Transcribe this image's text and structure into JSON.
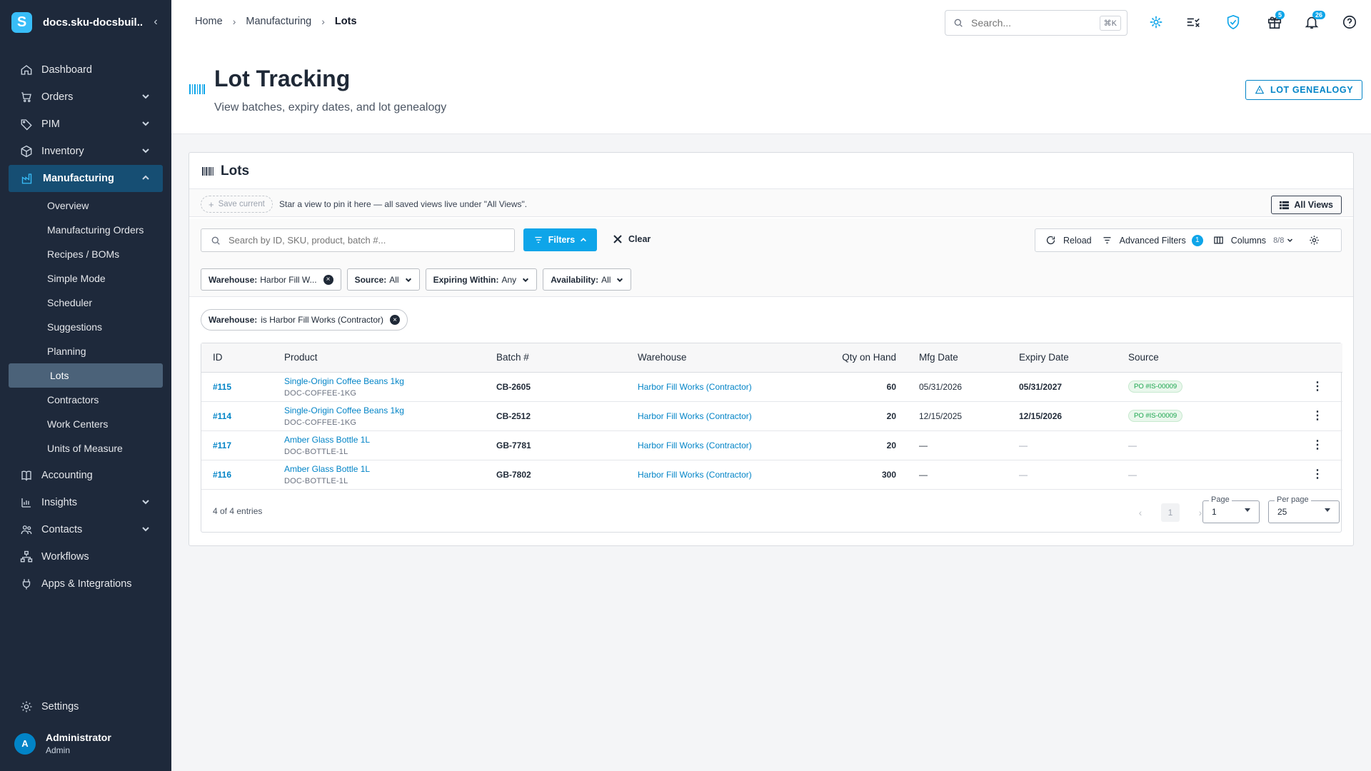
{
  "app": {
    "name": "docs.sku-docsbuil...",
    "logo_letter": "S"
  },
  "sidebar": {
    "items": [
      {
        "label": "Dashboard"
      },
      {
        "label": "Orders"
      },
      {
        "label": "PIM"
      },
      {
        "label": "Inventory"
      },
      {
        "label": "Manufacturing"
      }
    ],
    "manufacturing_sub": [
      {
        "label": "Overview"
      },
      {
        "label": "Manufacturing Orders"
      },
      {
        "label": "Recipes / BOMs"
      },
      {
        "label": "Simple Mode"
      },
      {
        "label": "Scheduler"
      },
      {
        "label": "Suggestions"
      },
      {
        "label": "Planning"
      },
      {
        "label": "Lots"
      },
      {
        "label": "Contractors"
      },
      {
        "label": "Work Centers"
      },
      {
        "label": "Units of Measure"
      }
    ],
    "items_after": [
      {
        "label": "Accounting"
      },
      {
        "label": "Insights"
      },
      {
        "label": "Contacts"
      },
      {
        "label": "Workflows"
      },
      {
        "label": "Apps & Integrations"
      }
    ],
    "settings_label": "Settings",
    "user": {
      "name": "Administrator",
      "role": "Admin",
      "initial": "A"
    }
  },
  "header": {
    "breadcrumb": [
      "Home",
      "Manufacturing",
      "Lots"
    ],
    "search_placeholder": "Search...",
    "search_shortcut": "⌘K",
    "gift_badge": "5",
    "notif_badge": "26"
  },
  "page": {
    "title": "Lot Tracking",
    "subtitle": "View batches, expiry dates, and lot genealogy",
    "genealogy_button": "LOT GENEALOGY"
  },
  "card": {
    "title": "Lots",
    "save_current": "Save current",
    "views_hint": "Star a view to pin it here — all saved views live under \"All Views\".",
    "all_views": "All Views",
    "search_placeholder": "Search by ID, SKU, product, batch #...",
    "filters_button": "Filters",
    "clear_button": "Clear",
    "reload": "Reload",
    "advanced_filters": "Advanced Filters",
    "advanced_filters_count": "1",
    "columns": "Columns",
    "columns_count": "8/8",
    "chips": [
      {
        "key": "Warehouse:",
        "value": "Harbor Fill W..."
      },
      {
        "key": "Source:",
        "value": "All"
      },
      {
        "key": "Expiring Within:",
        "value": "Any"
      },
      {
        "key": "Availability:",
        "value": "All"
      }
    ],
    "active_filter": {
      "key": "Warehouse:",
      "value": "is Harbor Fill Works (Contractor)"
    }
  },
  "table": {
    "columns": [
      "ID",
      "Product",
      "Batch #",
      "Warehouse",
      "Qty on Hand",
      "Mfg Date",
      "Expiry Date",
      "Source"
    ],
    "rows": [
      {
        "id": "#115",
        "product": "Single-Origin Coffee Beans 1kg",
        "sku": "DOC-COFFEE-1KG",
        "batch": "CB-2605",
        "warehouse": "Harbor Fill Works (Contractor)",
        "qty": "60",
        "mfg": "05/31/2026",
        "expiry": "05/31/2027",
        "source": "PO #IS-00009"
      },
      {
        "id": "#114",
        "product": "Single-Origin Coffee Beans 1kg",
        "sku": "DOC-COFFEE-1KG",
        "batch": "CB-2512",
        "warehouse": "Harbor Fill Works (Contractor)",
        "qty": "20",
        "mfg": "12/15/2025",
        "expiry": "12/15/2026",
        "source": "PO #IS-00009"
      },
      {
        "id": "#117",
        "product": "Amber Glass Bottle 1L",
        "sku": "DOC-BOTTLE-1L",
        "batch": "GB-7781",
        "warehouse": "Harbor Fill Works (Contractor)",
        "qty": "20",
        "mfg": "—",
        "expiry": "—",
        "source": "—"
      },
      {
        "id": "#116",
        "product": "Amber Glass Bottle 1L",
        "sku": "DOC-BOTTLE-1L",
        "batch": "GB-7802",
        "warehouse": "Harbor Fill Works (Contractor)",
        "qty": "300",
        "mfg": "—",
        "expiry": "—",
        "source": "—"
      }
    ],
    "entries": "4 of 4 entries",
    "page_current": "1",
    "page_label": "Page",
    "page_value": "1",
    "per_page_label": "Per page",
    "per_page_value": "25"
  }
}
